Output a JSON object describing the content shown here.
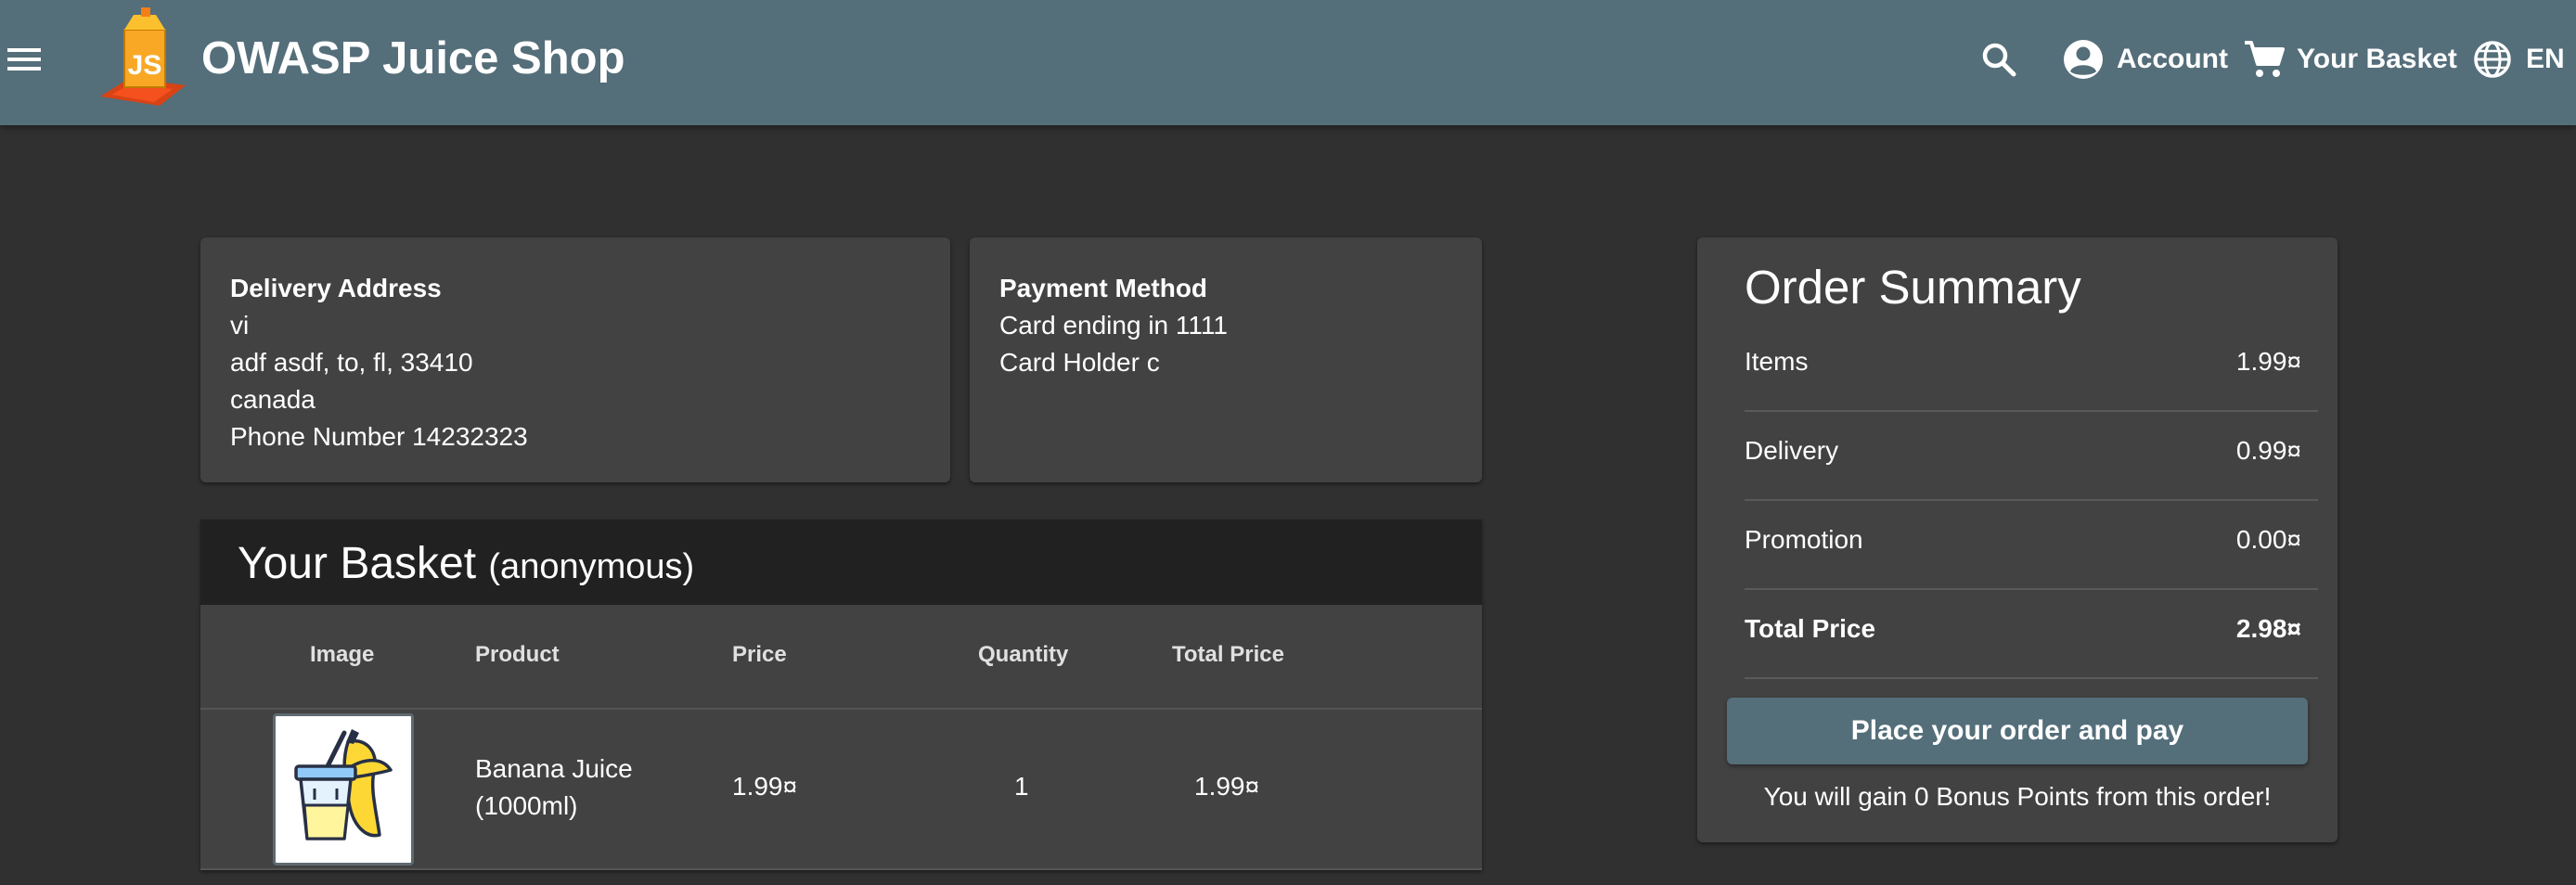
{
  "toolbar": {
    "title": "OWASP Juice Shop",
    "account_label": "Account",
    "basket_label": "Your Basket",
    "language_label": "EN",
    "background": "#546e7a"
  },
  "icons": [
    "menu-icon",
    "juice-shop-logo",
    "search-icon",
    "account-circle-icon",
    "shopping-cart-icon",
    "language-globe-icon"
  ],
  "delivery": {
    "heading": "Delivery Address",
    "name": "vi",
    "street": "adf asdf, to, fl, 33410",
    "country": "canada",
    "phone": "Phone Number 14232323"
  },
  "payment": {
    "heading": "Payment Method",
    "card": "Card ending in 1111",
    "holder": "Card Holder c"
  },
  "basket": {
    "title": "Your Basket",
    "owner": "(anonymous)",
    "columns": [
      "Image",
      "Product",
      "Price",
      "Quantity",
      "Total Price"
    ],
    "rows": [
      {
        "image": "banana-juice-image",
        "product_line1": "Banana Juice",
        "product_line2": "(1000ml)",
        "price": "1.99¤",
        "quantity": "1",
        "total": "1.99¤"
      }
    ]
  },
  "summary": {
    "title": "Order Summary",
    "rows": [
      {
        "label": "Items",
        "value": "1.99¤"
      },
      {
        "label": "Delivery",
        "value": "0.99¤"
      },
      {
        "label": "Promotion",
        "value": "0.00¤"
      },
      {
        "label": "Total Price",
        "value": "2.98¤"
      }
    ],
    "button": "Place your order and pay",
    "bonus": "You will gain 0 Bonus Points from this order!"
  },
  "colors": {
    "page_bg": "#303030",
    "card_bg": "#424242",
    "basket_header_bg": "#212121",
    "primary": "#546e7a"
  }
}
